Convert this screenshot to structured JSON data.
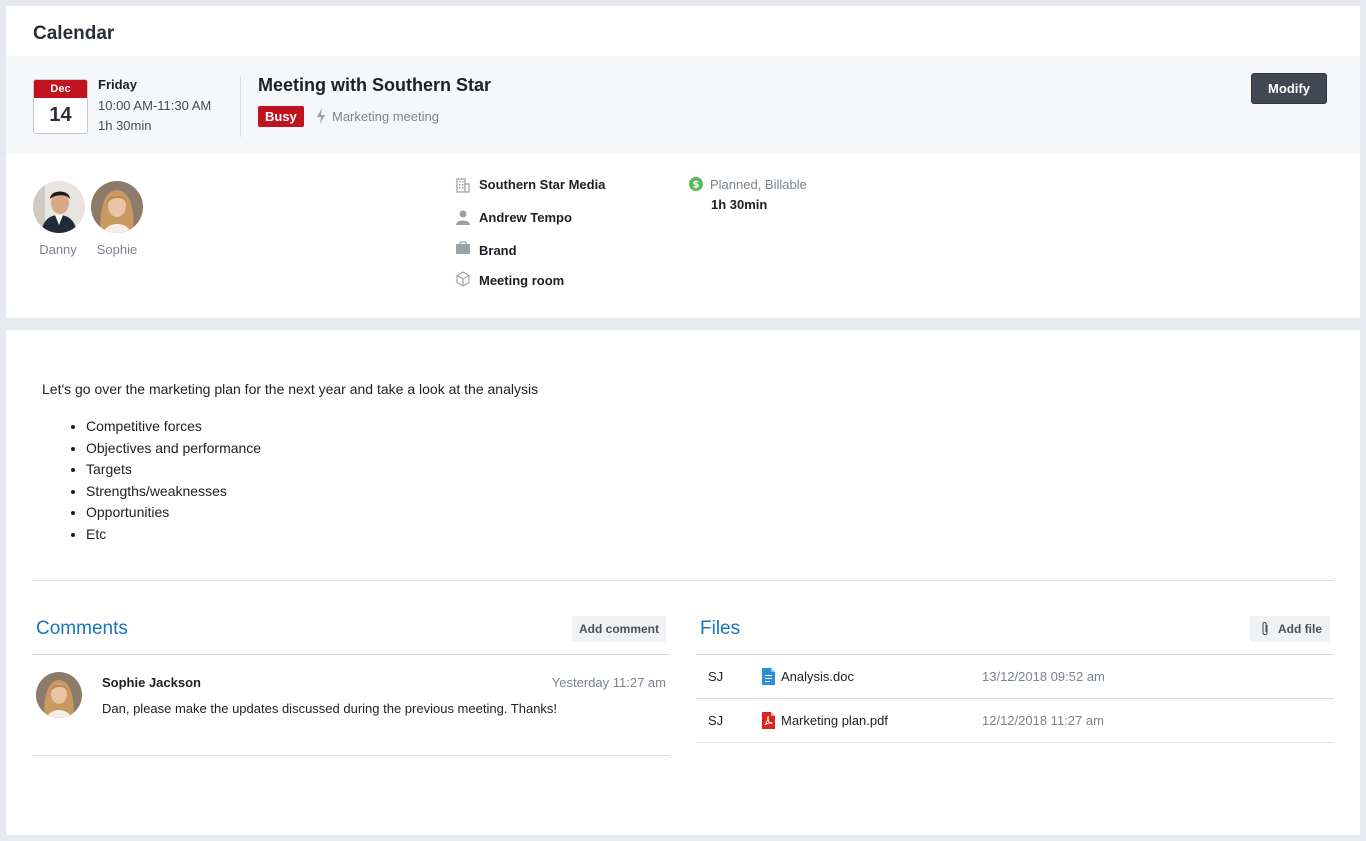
{
  "header": {
    "title": "Calendar"
  },
  "event": {
    "month": "Dec",
    "day": "14",
    "weekday": "Friday",
    "time_range": "10:00 AM-11:30 AM",
    "duration": "1h 30min",
    "title": "Meeting with Southern Star",
    "status": "Busy",
    "type_icon": "bolt-icon",
    "type": "Marketing meeting",
    "modify_label": "Modify"
  },
  "attendees": [
    {
      "name": "Danny"
    },
    {
      "name": "Sophie"
    }
  ],
  "details": {
    "company": "Southern Star Media",
    "contact": "Andrew Tempo",
    "project": "Brand",
    "resource": "Meeting room"
  },
  "billing": {
    "status": "Planned, Billable",
    "duration": "1h 30min"
  },
  "description": {
    "intro": "Let's go over the marketing plan for the next year and take a look at the analysis",
    "items": [
      "Competitive forces",
      "Objectives and performance",
      "Targets",
      "Strengths/weaknesses",
      "Opportunities",
      "Etc"
    ]
  },
  "comments": {
    "title": "Comments",
    "add_label": "Add comment",
    "items": [
      {
        "author": "Sophie Jackson",
        "time": "Yesterday 11:27 am",
        "text": "Dan, please make the updates discussed during the previous meeting. Thanks!"
      }
    ]
  },
  "files": {
    "title": "Files",
    "add_label": "Add file",
    "items": [
      {
        "owner": "SJ",
        "name": "Analysis.doc",
        "date": "13/12/2018 09:52 am",
        "icon": "doc-file-icon"
      },
      {
        "owner": "SJ",
        "name": "Marketing plan.pdf",
        "date": "12/12/2018 11:27 am",
        "icon": "pdf-file-icon"
      }
    ]
  },
  "colors": {
    "accent_blue": "#1a73c0",
    "busy_red": "#c1121f",
    "billable_green": "#5cb85c",
    "button_dark": "#3f4853"
  }
}
